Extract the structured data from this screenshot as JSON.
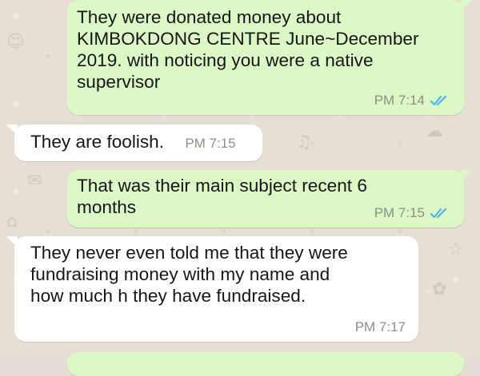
{
  "chat": {
    "messages": [
      {
        "direction": "outgoing",
        "text": "They were donated money about\nKIMBOKDONG CENTRE June~December\n2019. with noticing you were a native\nsupervisor",
        "time": "PM 7:14",
        "status": "read",
        "status_icon": "double-check-icon"
      },
      {
        "direction": "incoming",
        "text": "They are foolish.",
        "time": "PM 7:15"
      },
      {
        "direction": "outgoing",
        "text": "That was their main subject recent 6\nmonths",
        "time": "PM 7:15",
        "status": "read",
        "status_icon": "double-check-icon"
      },
      {
        "direction": "incoming",
        "text": "They never even told me that they were\nfundraising money with my name and\nhow much h they have fundraised.",
        "time": "PM 7:17"
      }
    ]
  },
  "colors": {
    "outgoing_bubble": "#dcf8c6",
    "incoming_bubble": "#ffffff",
    "read_ticks": "#4fb6ec",
    "timestamp": "#8c9086",
    "wallpaper": "#e5ddd5"
  }
}
